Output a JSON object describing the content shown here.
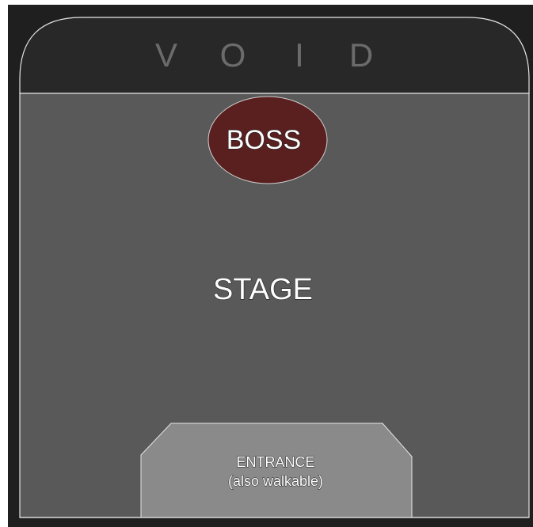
{
  "arena": {
    "void_label": "V O I D",
    "void_letters": [
      "V",
      "O",
      "I",
      "D"
    ],
    "boss_label": "BOSS",
    "stage_label": "STAGE",
    "entrance_label": "ENTRANCE",
    "entrance_sublabel": "(also walkable)"
  },
  "colors": {
    "background": "#1f1f1f",
    "void_region": "#282828",
    "stage_floor": "#595959",
    "boss_fill": "#5a1f1f",
    "entrance_fill": "#8a8a8a",
    "outline": "#e6e6e6"
  }
}
